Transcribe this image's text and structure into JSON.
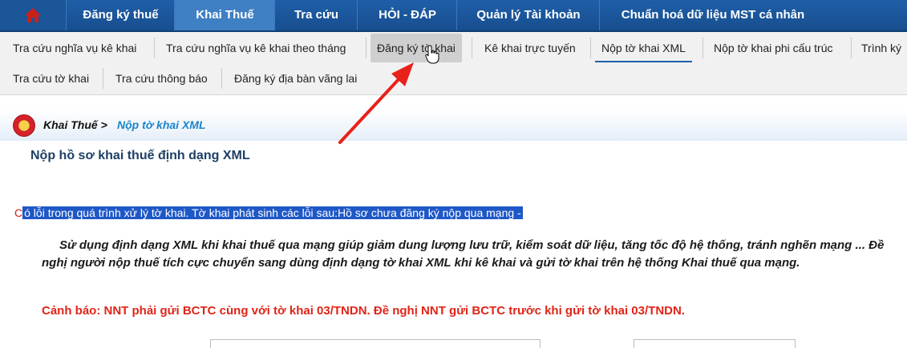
{
  "topnav": {
    "items": [
      {
        "label": "Đăng ký thuế"
      },
      {
        "label": "Khai Thuế"
      },
      {
        "label": "Tra cứu"
      },
      {
        "label": "HỎI - ĐÁP"
      },
      {
        "label": "Quản lý Tài khoản"
      },
      {
        "label": "Chuẩn hoá dữ liệu MST cá nhân"
      }
    ],
    "active_index": 1,
    "home_icon": "home-icon"
  },
  "subnav": {
    "row1": [
      {
        "label": "Tra cứu nghĩa vụ kê khai"
      },
      {
        "label": "Tra cứu nghĩa vụ kê khai theo tháng"
      },
      {
        "label": "Đăng ký tờ khai"
      },
      {
        "label": "Kê khai trực tuyến"
      },
      {
        "label": "Nộp tờ khai XML"
      },
      {
        "label": "Nộp tờ khai phi cấu trúc"
      },
      {
        "label": "Trình ký"
      }
    ],
    "row2": [
      {
        "label": "Tra cứu tờ khai"
      },
      {
        "label": "Tra cứu thông báo"
      },
      {
        "label": "Đăng ký địa bàn vãng lai"
      }
    ]
  },
  "breadcrumb": {
    "root": "Khai Thuế",
    "separator": ">",
    "current": "Nộp tờ khai XML"
  },
  "page": {
    "title": "Nộp hồ sơ khai thuế định dạng XML",
    "error_first_char": "C",
    "error_rest": "ó lỗi trong quá trình xử lý tờ khai. Tờ khai phát sinh các lỗi sau:Hồ sơ chưa đăng ký nộp qua mạng -",
    "intro": "Sử dụng định dạng XML khi khai thuế qua mạng giúp giảm dung lượng lưu trữ, kiểm soát dữ liệu, tăng tốc độ hệ thống, tránh nghẽn mạng ... Đề nghị người nộp thuế tích cực chuyển sang dùng định dạng tờ khai XML khi kê khai và gửi tờ khai trên hệ thống Khai thuế qua mạng.",
    "warning": "Cảnh báo: NNT phải gửi BCTC cùng với tờ khai 03/TNDN. Đề nghị NNT gửi BCTC trước khi gửi tờ khai 03/TNDN."
  },
  "colors": {
    "nav_bg": "#1f5fa8",
    "nav_active": "#3f7fc4",
    "breadcrumb_link": "#1a84c8",
    "error_highlight": "#1e58c8",
    "warning": "#e02417",
    "annotation_arrow": "#e8211b"
  }
}
